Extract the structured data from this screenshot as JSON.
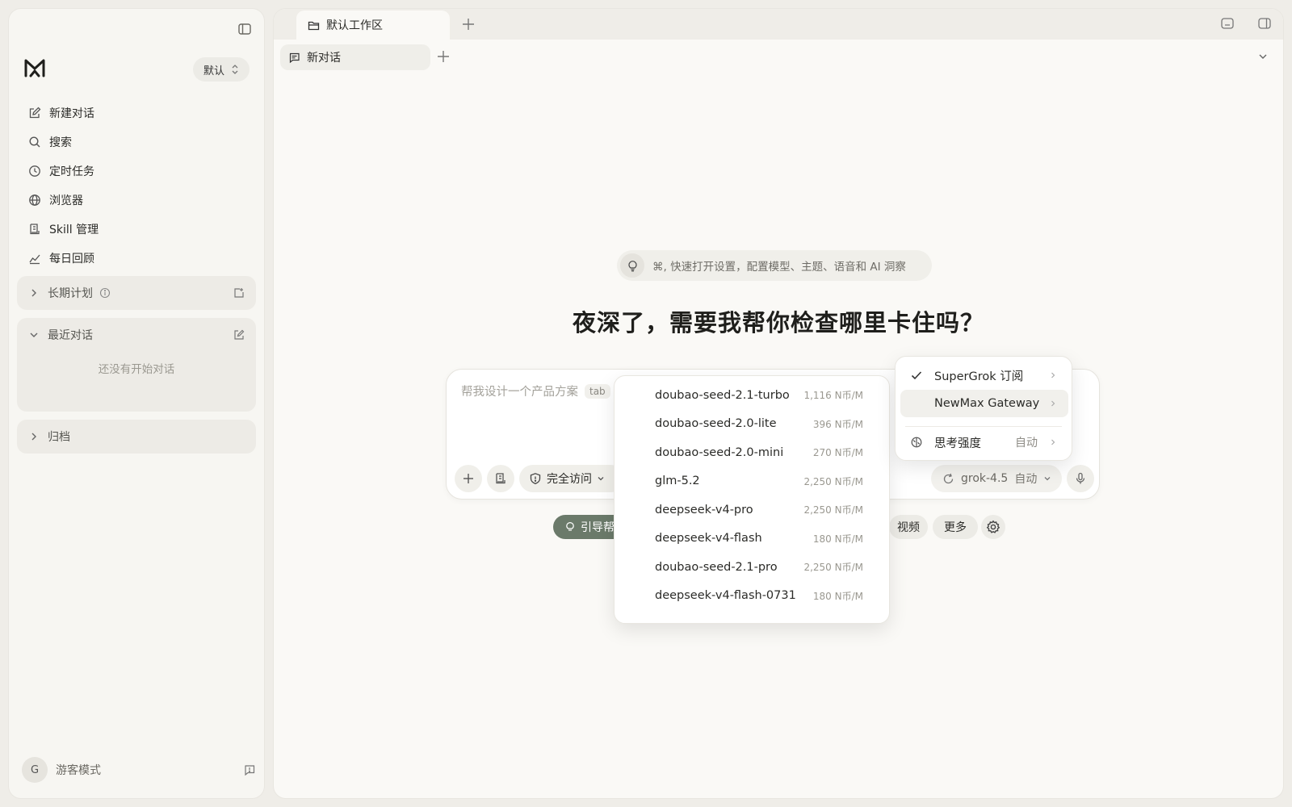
{
  "sidebar": {
    "workspace_select": "默认",
    "nav": [
      {
        "label": "新建对话",
        "icon": "edit-icon"
      },
      {
        "label": "搜索",
        "icon": "search-icon"
      },
      {
        "label": "定时任务",
        "icon": "clock-icon"
      },
      {
        "label": "浏览器",
        "icon": "globe-icon"
      },
      {
        "label": "Skill 管理",
        "icon": "scroll-icon"
      },
      {
        "label": "每日回顾",
        "icon": "chart-icon"
      }
    ],
    "sections": {
      "long_term": "长期计划",
      "recent": "最近对话",
      "recent_empty": "还没有开始对话",
      "archive": "归档"
    },
    "user": {
      "initial": "G",
      "name": "游客模式"
    }
  },
  "tabs": {
    "workspace_tab": "默认工作区",
    "conversation_tab": "新对话"
  },
  "main": {
    "hint": "⌘, 快速打开设置，配置模型、主题、语音和 AI 洞察",
    "headline": "夜深了，需要我帮你检查哪里卡住吗？",
    "composer": {
      "placeholder": "帮我设计一个产品方案",
      "tab_key": "tab",
      "access_label": "完全访问",
      "model_name": "grok-4.5",
      "model_mode": "自动"
    },
    "chips": {
      "guide": "引导帮",
      "video": "视频",
      "more": "更多"
    }
  },
  "model_list": [
    {
      "name": "doubao-seed-2.1-turbo",
      "price": "1,116 N币/M"
    },
    {
      "name": "doubao-seed-2.0-lite",
      "price": "396 N币/M"
    },
    {
      "name": "doubao-seed-2.0-mini",
      "price": "270 N币/M"
    },
    {
      "name": "glm-5.2",
      "price": "2,250 N币/M"
    },
    {
      "name": "deepseek-v4-pro",
      "price": "2,250 N币/M"
    },
    {
      "name": "deepseek-v4-flash",
      "price": "180 N币/M"
    },
    {
      "name": "doubao-seed-2.1-pro",
      "price": "2,250 N币/M"
    },
    {
      "name": "deepseek-v4-flash-0731",
      "price": "180 N币/M"
    }
  ],
  "provider_menu": {
    "supergrok": "SuperGrok 订阅",
    "newmax": "NewMax Gateway",
    "thinking": "思考强度",
    "thinking_value": "自动"
  },
  "colors": {
    "accent_green": "#6b7a6a",
    "background": "#efede8",
    "panel": "#faf9f6"
  }
}
